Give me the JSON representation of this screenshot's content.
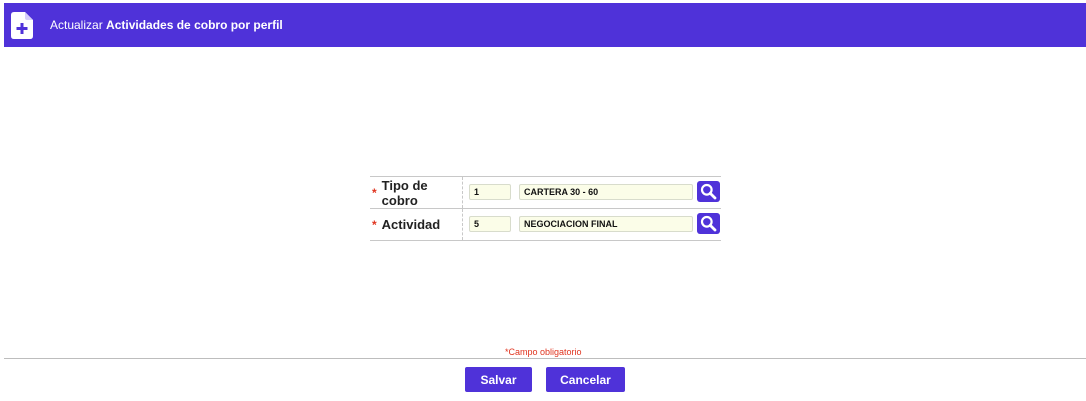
{
  "header": {
    "title_prefix": "Actualizar",
    "title_main": "Actividades de cobro por perfil",
    "icon": "file-plus-icon"
  },
  "form": {
    "rows": [
      {
        "label": "Tipo de cobro",
        "required_mark": "*",
        "code": "1",
        "description": "CARTERA 30 - 60",
        "search_icon": "search-icon"
      },
      {
        "label": "Actividad",
        "required_mark": "*",
        "code": "5",
        "description": "NEGOCIACION FINAL",
        "search_icon": "search-icon"
      }
    ]
  },
  "footer": {
    "required_note": "*Campo obligatorio",
    "save_label": "Salvar",
    "cancel_label": "Cancelar"
  },
  "colors": {
    "accent": "#4f32d9",
    "required": "#e0341f",
    "input_bg": "#fbfde8"
  }
}
